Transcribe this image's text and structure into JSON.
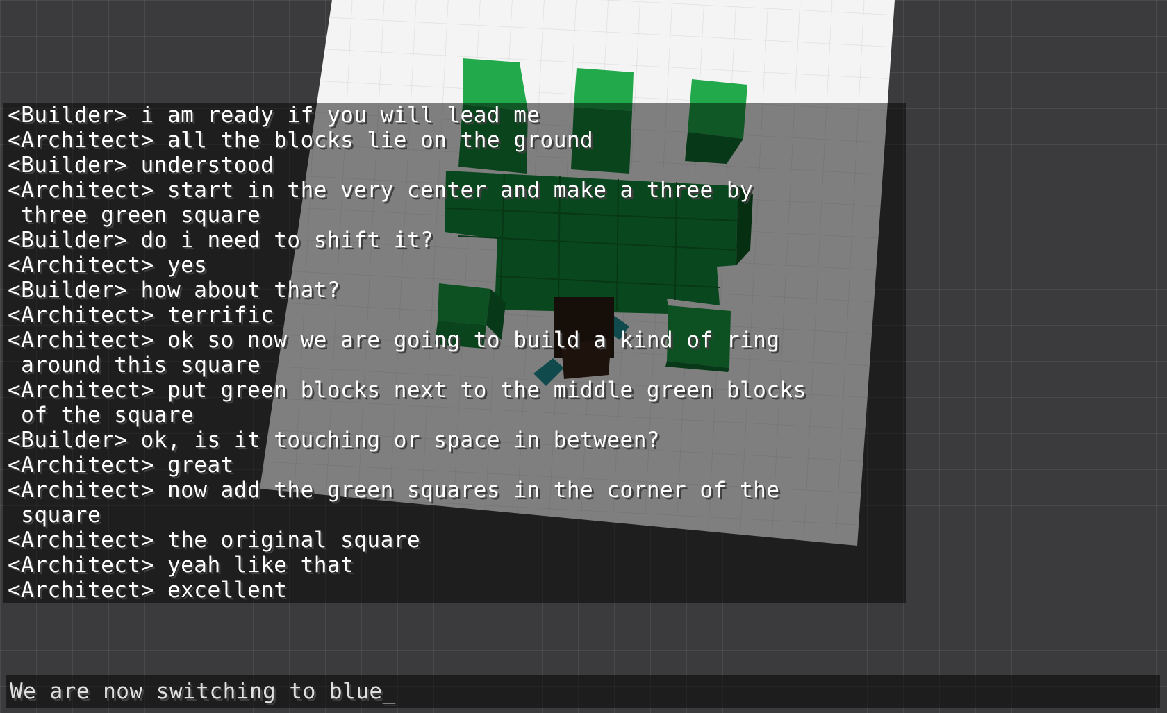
{
  "chat": {
    "lines": [
      "<Builder> i am ready if you will lead me",
      "<Architect> all the blocks lie on the ground",
      "<Builder> understood",
      "<Architect> start in the very center and make a three by",
      " three green square",
      "<Builder> do i need to shift it?",
      "<Architect> yes",
      "<Builder> how about that?",
      "<Architect> terrific",
      "<Architect> ok so now we are going to build a kind of ring",
      " around this square",
      "<Architect> put green blocks next to the middle green blocks",
      " of the square",
      "<Builder> ok, is it touching or space in between?",
      "<Architect> great",
      "<Architect> now add the green squares in the corner of the",
      " square",
      "<Architect> the original square",
      "<Architect> yeah like that",
      "<Architect> excellent"
    ],
    "input": {
      "value": "We are now switching to blue",
      "cursor": "_"
    }
  },
  "world": {
    "block_color": "green",
    "colors": {
      "ground": "#3b3b3d",
      "build_platform": "#f4f4f4",
      "block_top": "#22a94b",
      "block_side": "#0f6b2c",
      "block_mid": "#158237",
      "player_head": "#3a241a",
      "player_shirt": "#1f8e93"
    },
    "icons": {
      "player": "builder-avatar-icon"
    }
  }
}
